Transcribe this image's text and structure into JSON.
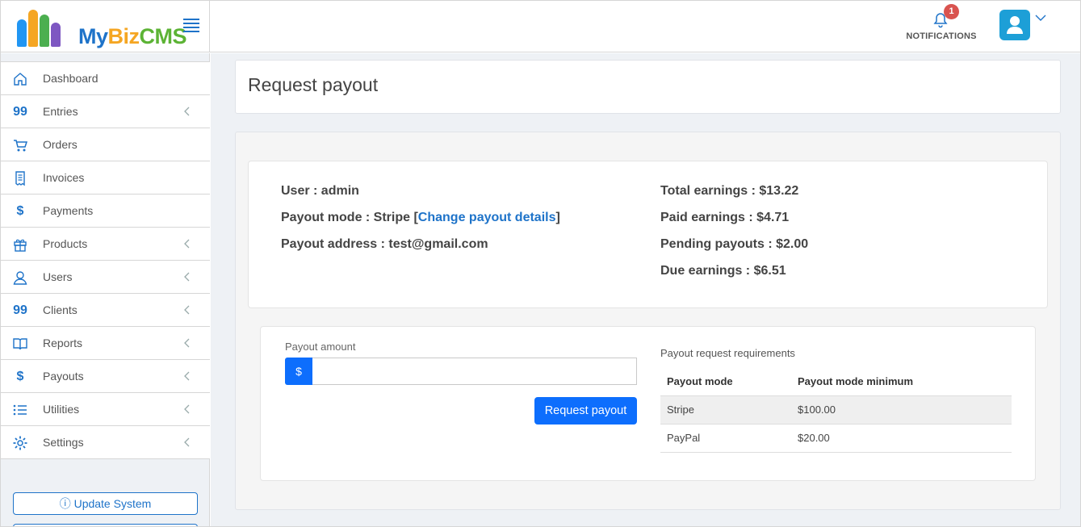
{
  "header": {
    "logo": {
      "my": "My",
      "biz": "Biz",
      "cms": "CMS"
    },
    "notifications": {
      "label": "NOTIFICATIONS",
      "count": "1"
    }
  },
  "sidebar": {
    "items": [
      {
        "label": "Dashboard",
        "icon": "home-icon",
        "glyph": "",
        "has_children": false
      },
      {
        "label": "Entries",
        "icon": "quote-icon",
        "glyph": "99",
        "has_children": true
      },
      {
        "label": "Orders",
        "icon": "cart-icon",
        "glyph": "",
        "has_children": false
      },
      {
        "label": "Invoices",
        "icon": "receipt-icon",
        "glyph": "",
        "has_children": false
      },
      {
        "label": "Payments",
        "icon": "dollar-icon",
        "glyph": "$",
        "has_children": false
      },
      {
        "label": "Products",
        "icon": "gift-icon",
        "glyph": "",
        "has_children": true
      },
      {
        "label": "Users",
        "icon": "user-icon",
        "glyph": "",
        "has_children": true
      },
      {
        "label": "Clients",
        "icon": "quote-icon",
        "glyph": "99",
        "has_children": true
      },
      {
        "label": "Reports",
        "icon": "book-icon",
        "glyph": "",
        "has_children": true
      },
      {
        "label": "Payouts",
        "icon": "dollar-icon",
        "glyph": "$",
        "has_children": true
      },
      {
        "label": "Utilities",
        "icon": "list-icon",
        "glyph": "",
        "has_children": true
      },
      {
        "label": "Settings",
        "icon": "gear-icon",
        "glyph": "",
        "has_children": true
      }
    ],
    "update_button": "Update System"
  },
  "page": {
    "title": "Request payout",
    "info": {
      "user": "User : admin",
      "payout_mode_prefix": "Payout mode : Stripe [",
      "change_link": "Change payout details",
      "payout_mode_suffix": "]",
      "payout_address": "Payout address : test@gmail.com",
      "total_earnings": "Total earnings : $13.22",
      "paid_earnings": "Paid earnings : $4.71",
      "pending_payouts": "Pending payouts : $2.00",
      "due_earnings": "Due earnings : $6.51"
    },
    "form": {
      "amount_label": "Payout amount",
      "currency_addon": "$",
      "amount_value": "",
      "submit_label": "Request payout"
    },
    "requirements": {
      "title": "Payout request requirements",
      "headers": [
        "Payout mode",
        "Payout mode minimum"
      ],
      "rows": [
        [
          "Stripe",
          "$100.00"
        ],
        [
          "PayPal",
          "$20.00"
        ]
      ]
    }
  },
  "colors": {
    "accent": "#1e73c9",
    "button": "#0d6efd",
    "badge": "#d9534f",
    "avatar": "#1d9fd7"
  }
}
